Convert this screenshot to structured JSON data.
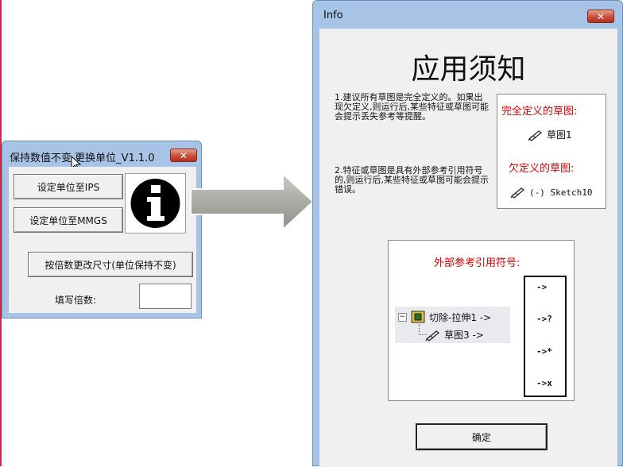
{
  "dialog_main": {
    "title": "保持数值不变,更换单位_V1.1.0",
    "close_label": "✕",
    "btn_ips": "设定单位至IPS",
    "btn_mmgs": "设定单位至MMGS",
    "btn_scale": "按倍数更改尺寸(单位保持不变)",
    "multiplier_label": "填写倍数:",
    "multiplier_value": ""
  },
  "dialog_info": {
    "title": "Info",
    "close_label": "✕",
    "heading": "应用须知",
    "note1": "1.建议所有草图是完全定义的。如果出现欠定义,则运行后,某些特征或草图可能会提示丢失参考等提醒。",
    "note2": "2.特征或草图是具有外部参考引用符号的,则运行后,某些特征或草图可能会提示错误。",
    "fully_defined_label": "完全定义的草图:",
    "fully_defined_item": "草图1",
    "under_defined_label": "欠定义的草图:",
    "under_defined_item": "(-) Sketch10",
    "external_ref_label": "外部参考引用符号:",
    "tree_feature": "切除-拉伸1 ->",
    "tree_sketch": "草图3 ->",
    "tree_expand": "−",
    "symbols": [
      "->",
      "->?",
      "->*",
      "->x"
    ],
    "ok_label": "确定"
  },
  "colors": {
    "title_bar": "#a7c4e6",
    "close_button": "#c8503a",
    "warning_text": "#e00000"
  }
}
